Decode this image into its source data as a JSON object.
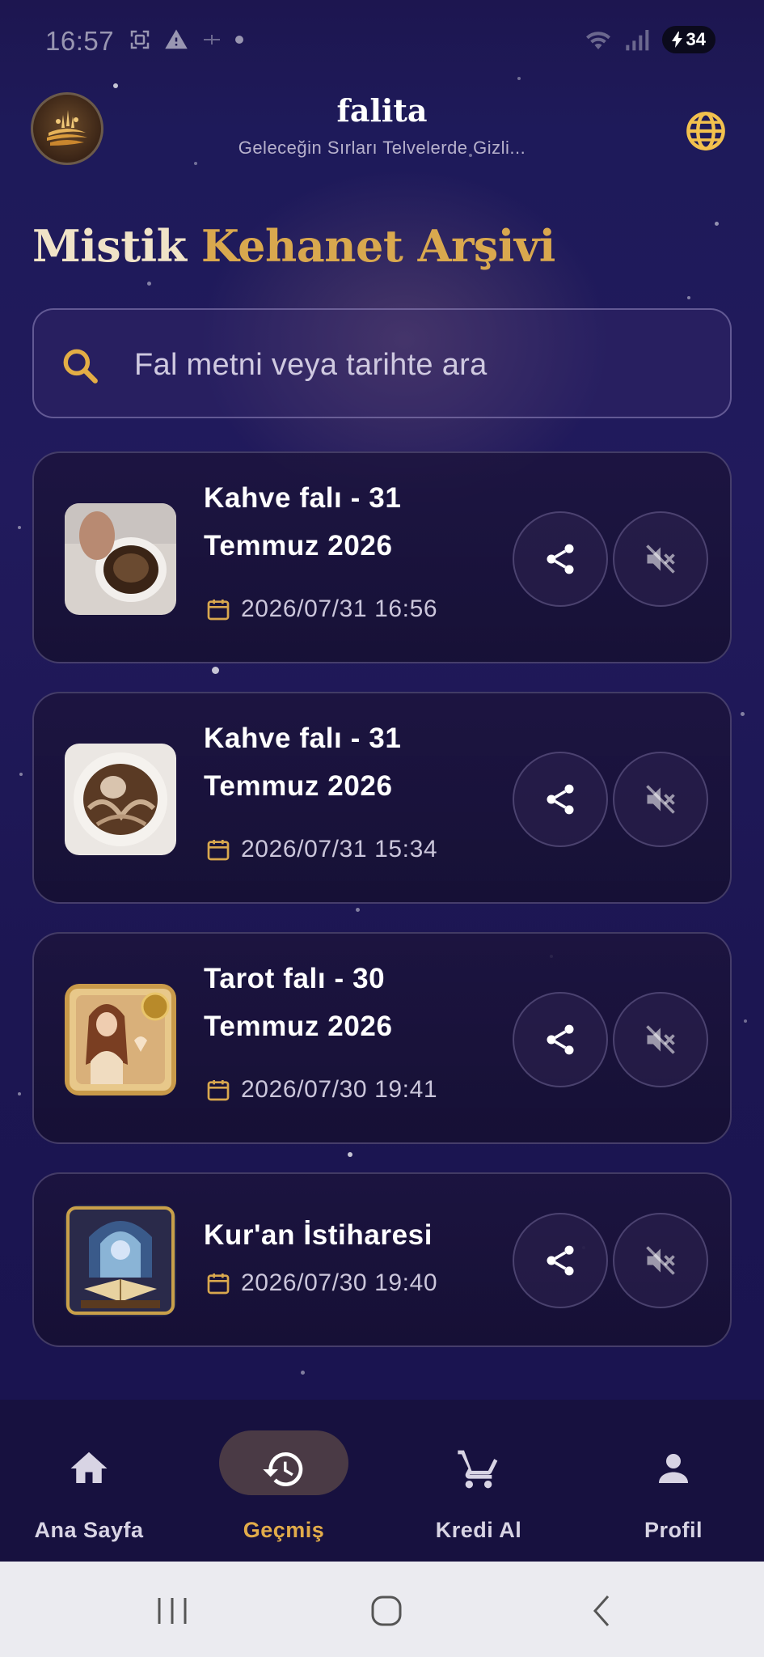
{
  "status_bar": {
    "time": "16:57",
    "battery": "34",
    "icons": [
      "screenshot-icon",
      "alert-icon",
      "cast-icon",
      "dot-icon",
      "wifi-icon",
      "signal-icon",
      "battery-charging-icon"
    ]
  },
  "header": {
    "title": "falita",
    "subtitle": "Geleceğin Sırları Telvelerde Gizli...",
    "logo_icon": "falita-logo-icon",
    "language_icon": "globe-icon"
  },
  "page": {
    "title_part1": "Mistik",
    "title_part2": "Kehanet Arşivi"
  },
  "search": {
    "placeholder": "Fal metni veya tarihte ara",
    "value": "",
    "icon": "search-icon"
  },
  "readings": [
    {
      "title": "Kahve falı - 31 Temmuz 2026",
      "date": "2026/07/31 16:56",
      "thumbnail": "coffee-cup-thumbnail"
    },
    {
      "title": "Kahve falı - 31 Temmuz 2026",
      "date": "2026/07/31 15:34",
      "thumbnail": "coffee-cup-grounds-thumbnail"
    },
    {
      "title": "Tarot falı - 30 Temmuz 2026",
      "date": "2026/07/30 19:41",
      "thumbnail": "tarot-card-thumbnail"
    },
    {
      "title": "Kur'an İstiharesi",
      "date": "2026/07/30 19:40",
      "thumbnail": "quran-thumbnail"
    }
  ],
  "card_actions": {
    "share_icon": "share-icon",
    "audio_icon": "volume-off-icon"
  },
  "bottom_nav": [
    {
      "label": "Ana Sayfa",
      "icon": "home-icon",
      "active": false
    },
    {
      "label": "Geçmiş",
      "icon": "history-icon",
      "active": true
    },
    {
      "label": "Kredi Al",
      "icon": "cart-icon",
      "active": false
    },
    {
      "label": "Profil",
      "icon": "person-icon",
      "active": false
    }
  ],
  "colors": {
    "background": "#1e1a5a",
    "accent_gold": "#d9a84e",
    "title_cream": "#f0e3c7",
    "nav_active": "#e2ac4a",
    "nav_inactive": "#d8d4e4"
  }
}
